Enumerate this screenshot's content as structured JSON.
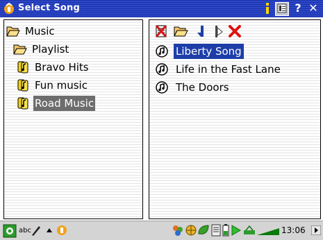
{
  "window": {
    "title": "Select Song"
  },
  "tree": {
    "items": [
      {
        "label": "Music"
      },
      {
        "label": "Playlist"
      },
      {
        "label": "Bravo Hits"
      },
      {
        "label": "Fun music"
      },
      {
        "label": "Road Music"
      }
    ]
  },
  "songs": {
    "items": [
      {
        "label": "Liberty Song"
      },
      {
        "label": "Life in the Fast Lane"
      },
      {
        "label": "The Doors"
      }
    ]
  },
  "taskbar": {
    "input_mode": "abc",
    "clock": "13:06"
  },
  "colors": {
    "titlebar": "#2b46c7",
    "selected_song_bg": "#1d3ea8",
    "selected_tree_bg": "#6d6d6d",
    "taskbar_bg": "#d4d4d4"
  }
}
